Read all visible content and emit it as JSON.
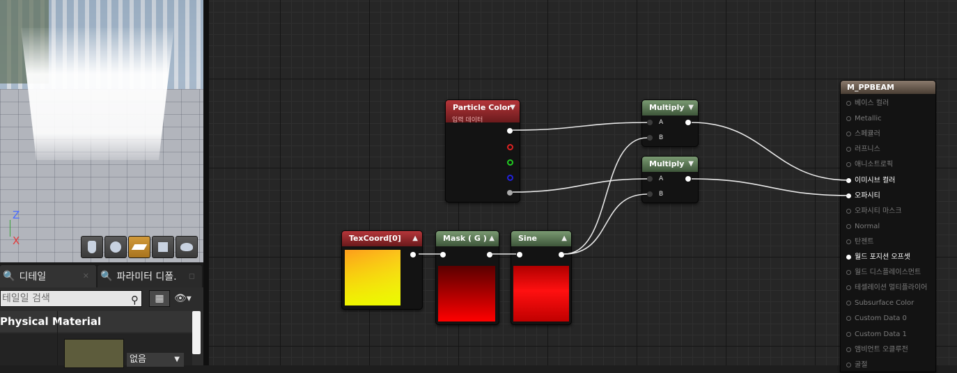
{
  "viewport": {
    "axis_z": "Z",
    "axis_x": "X",
    "preview_buttons": [
      {
        "name": "cylinder-icon"
      },
      {
        "name": "sphere-icon"
      },
      {
        "name": "plane-icon"
      },
      {
        "name": "cube-icon"
      },
      {
        "name": "teapot-icon"
      }
    ],
    "active_preview": 2
  },
  "details": {
    "tabs": [
      {
        "label": "디테일",
        "icon": "🔍"
      },
      {
        "label": "파라미터 디폴.",
        "icon": "🔍"
      }
    ],
    "search_placeholder": "테일일 검색",
    "category": "Physical Material",
    "combo_value": "없음",
    "grid_icon": "▦",
    "eye_icon": "👁▾"
  },
  "graph": {
    "nodes": {
      "particle_color": {
        "title": "Particle Color",
        "subtitle": "입력 데이터"
      },
      "multiply1": {
        "title": "Multiply",
        "pins": [
          "A",
          "B"
        ]
      },
      "multiply2": {
        "title": "Multiply",
        "pins": [
          "A",
          "B"
        ]
      },
      "texcoord": {
        "title": "TexCoord[0]"
      },
      "mask": {
        "title": "Mask ( G )"
      },
      "sine": {
        "title": "Sine"
      }
    },
    "result": {
      "title": "M_PPBEAM",
      "inputs": [
        {
          "label": "베이스 컬러",
          "active": false
        },
        {
          "label": "Metallic",
          "active": false
        },
        {
          "label": "스페큘러",
          "active": false
        },
        {
          "label": "러프니스",
          "active": false
        },
        {
          "label": "애니소트로픽",
          "active": false
        },
        {
          "label": "이미시브 컬러",
          "active": true
        },
        {
          "label": "오파시티",
          "active": true
        },
        {
          "label": "오파시티 마스크",
          "active": false
        },
        {
          "label": "Normal",
          "active": false
        },
        {
          "label": "탄젠트",
          "active": false
        },
        {
          "label": "월드 포지션 오프셋",
          "active": true
        },
        {
          "label": "월드 디스플레이스먼트",
          "active": false
        },
        {
          "label": "테셀레이션 멀티플라이어",
          "active": false
        },
        {
          "label": "Subsurface Color",
          "active": false
        },
        {
          "label": "Custom Data 0",
          "active": false
        },
        {
          "label": "Custom Data 1",
          "active": false
        },
        {
          "label": "앰비언트 오클루전",
          "active": false
        },
        {
          "label": "굴절",
          "active": false
        }
      ]
    }
  }
}
